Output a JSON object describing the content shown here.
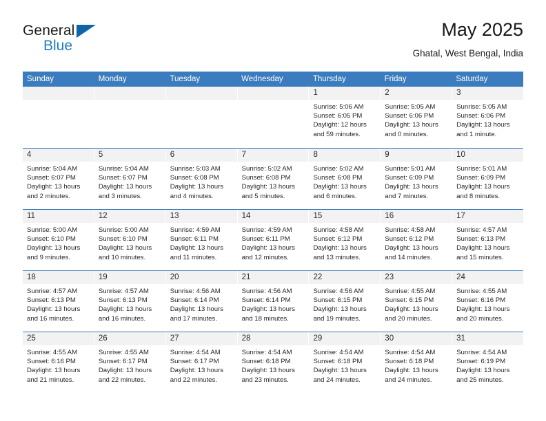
{
  "brand": {
    "name_part1": "General",
    "name_part2": "Blue",
    "accent_color": "#1d7cc4",
    "triangle_color": "#1064a8"
  },
  "header": {
    "title": "May 2025",
    "subtitle": "Ghatal, West Bengal, India"
  },
  "calendar": {
    "header_bg": "#3a7cbe",
    "daynum_bg": "#f2f2f2",
    "weekday_names": [
      "Sunday",
      "Monday",
      "Tuesday",
      "Wednesday",
      "Thursday",
      "Friday",
      "Saturday"
    ],
    "weeks": [
      [
        {
          "day": "",
          "empty": true,
          "sunrise": "",
          "sunset": "",
          "daylight": ""
        },
        {
          "day": "",
          "empty": true,
          "sunrise": "",
          "sunset": "",
          "daylight": ""
        },
        {
          "day": "",
          "empty": true,
          "sunrise": "",
          "sunset": "",
          "daylight": ""
        },
        {
          "day": "",
          "empty": true,
          "sunrise": "",
          "sunset": "",
          "daylight": ""
        },
        {
          "day": "1",
          "sunrise": "Sunrise: 5:06 AM",
          "sunset": "Sunset: 6:05 PM",
          "daylight": "Daylight: 12 hours and 59 minutes."
        },
        {
          "day": "2",
          "sunrise": "Sunrise: 5:05 AM",
          "sunset": "Sunset: 6:06 PM",
          "daylight": "Daylight: 13 hours and 0 minutes."
        },
        {
          "day": "3",
          "sunrise": "Sunrise: 5:05 AM",
          "sunset": "Sunset: 6:06 PM",
          "daylight": "Daylight: 13 hours and 1 minute."
        }
      ],
      [
        {
          "day": "4",
          "sunrise": "Sunrise: 5:04 AM",
          "sunset": "Sunset: 6:07 PM",
          "daylight": "Daylight: 13 hours and 2 minutes."
        },
        {
          "day": "5",
          "sunrise": "Sunrise: 5:04 AM",
          "sunset": "Sunset: 6:07 PM",
          "daylight": "Daylight: 13 hours and 3 minutes."
        },
        {
          "day": "6",
          "sunrise": "Sunrise: 5:03 AM",
          "sunset": "Sunset: 6:08 PM",
          "daylight": "Daylight: 13 hours and 4 minutes."
        },
        {
          "day": "7",
          "sunrise": "Sunrise: 5:02 AM",
          "sunset": "Sunset: 6:08 PM",
          "daylight": "Daylight: 13 hours and 5 minutes."
        },
        {
          "day": "8",
          "sunrise": "Sunrise: 5:02 AM",
          "sunset": "Sunset: 6:08 PM",
          "daylight": "Daylight: 13 hours and 6 minutes."
        },
        {
          "day": "9",
          "sunrise": "Sunrise: 5:01 AM",
          "sunset": "Sunset: 6:09 PM",
          "daylight": "Daylight: 13 hours and 7 minutes."
        },
        {
          "day": "10",
          "sunrise": "Sunrise: 5:01 AM",
          "sunset": "Sunset: 6:09 PM",
          "daylight": "Daylight: 13 hours and 8 minutes."
        }
      ],
      [
        {
          "day": "11",
          "sunrise": "Sunrise: 5:00 AM",
          "sunset": "Sunset: 6:10 PM",
          "daylight": "Daylight: 13 hours and 9 minutes."
        },
        {
          "day": "12",
          "sunrise": "Sunrise: 5:00 AM",
          "sunset": "Sunset: 6:10 PM",
          "daylight": "Daylight: 13 hours and 10 minutes."
        },
        {
          "day": "13",
          "sunrise": "Sunrise: 4:59 AM",
          "sunset": "Sunset: 6:11 PM",
          "daylight": "Daylight: 13 hours and 11 minutes."
        },
        {
          "day": "14",
          "sunrise": "Sunrise: 4:59 AM",
          "sunset": "Sunset: 6:11 PM",
          "daylight": "Daylight: 13 hours and 12 minutes."
        },
        {
          "day": "15",
          "sunrise": "Sunrise: 4:58 AM",
          "sunset": "Sunset: 6:12 PM",
          "daylight": "Daylight: 13 hours and 13 minutes."
        },
        {
          "day": "16",
          "sunrise": "Sunrise: 4:58 AM",
          "sunset": "Sunset: 6:12 PM",
          "daylight": "Daylight: 13 hours and 14 minutes."
        },
        {
          "day": "17",
          "sunrise": "Sunrise: 4:57 AM",
          "sunset": "Sunset: 6:13 PM",
          "daylight": "Daylight: 13 hours and 15 minutes."
        }
      ],
      [
        {
          "day": "18",
          "sunrise": "Sunrise: 4:57 AM",
          "sunset": "Sunset: 6:13 PM",
          "daylight": "Daylight: 13 hours and 16 minutes."
        },
        {
          "day": "19",
          "sunrise": "Sunrise: 4:57 AM",
          "sunset": "Sunset: 6:13 PM",
          "daylight": "Daylight: 13 hours and 16 minutes."
        },
        {
          "day": "20",
          "sunrise": "Sunrise: 4:56 AM",
          "sunset": "Sunset: 6:14 PM",
          "daylight": "Daylight: 13 hours and 17 minutes."
        },
        {
          "day": "21",
          "sunrise": "Sunrise: 4:56 AM",
          "sunset": "Sunset: 6:14 PM",
          "daylight": "Daylight: 13 hours and 18 minutes."
        },
        {
          "day": "22",
          "sunrise": "Sunrise: 4:56 AM",
          "sunset": "Sunset: 6:15 PM",
          "daylight": "Daylight: 13 hours and 19 minutes."
        },
        {
          "day": "23",
          "sunrise": "Sunrise: 4:55 AM",
          "sunset": "Sunset: 6:15 PM",
          "daylight": "Daylight: 13 hours and 20 minutes."
        },
        {
          "day": "24",
          "sunrise": "Sunrise: 4:55 AM",
          "sunset": "Sunset: 6:16 PM",
          "daylight": "Daylight: 13 hours and 20 minutes."
        }
      ],
      [
        {
          "day": "25",
          "sunrise": "Sunrise: 4:55 AM",
          "sunset": "Sunset: 6:16 PM",
          "daylight": "Daylight: 13 hours and 21 minutes."
        },
        {
          "day": "26",
          "sunrise": "Sunrise: 4:55 AM",
          "sunset": "Sunset: 6:17 PM",
          "daylight": "Daylight: 13 hours and 22 minutes."
        },
        {
          "day": "27",
          "sunrise": "Sunrise: 4:54 AM",
          "sunset": "Sunset: 6:17 PM",
          "daylight": "Daylight: 13 hours and 22 minutes."
        },
        {
          "day": "28",
          "sunrise": "Sunrise: 4:54 AM",
          "sunset": "Sunset: 6:18 PM",
          "daylight": "Daylight: 13 hours and 23 minutes."
        },
        {
          "day": "29",
          "sunrise": "Sunrise: 4:54 AM",
          "sunset": "Sunset: 6:18 PM",
          "daylight": "Daylight: 13 hours and 24 minutes."
        },
        {
          "day": "30",
          "sunrise": "Sunrise: 4:54 AM",
          "sunset": "Sunset: 6:18 PM",
          "daylight": "Daylight: 13 hours and 24 minutes."
        },
        {
          "day": "31",
          "sunrise": "Sunrise: 4:54 AM",
          "sunset": "Sunset: 6:19 PM",
          "daylight": "Daylight: 13 hours and 25 minutes."
        }
      ]
    ]
  }
}
